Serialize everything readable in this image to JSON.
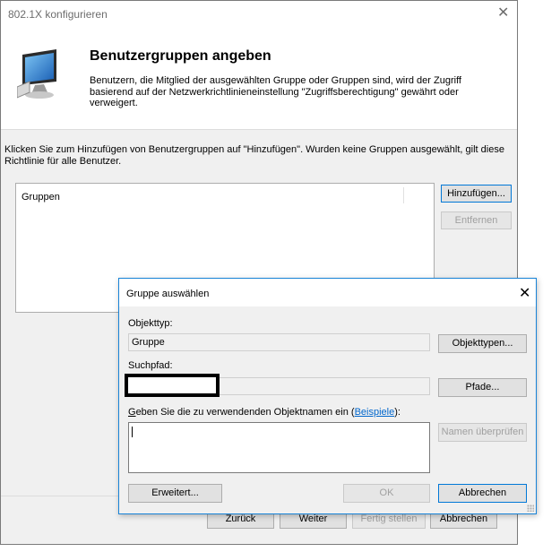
{
  "window": {
    "title": "802.1X konfigurieren",
    "close_glyph": "✕"
  },
  "header": {
    "icon": "monitor-icon",
    "title": "Benutzergruppen angeben",
    "description": "Benutzern, die Mitglied der ausgewählten Gruppe oder Gruppen sind, wird der Zugriff basierend auf der Netzwerkrichtlinieneinstellung \"Zugriffsberechtigung\" gewährt oder verweigert."
  },
  "info_text": "Klicken Sie zum Hinzufügen von Benutzergruppen auf \"Hinzufügen\". Wurden keine Gruppen ausgewählt, gilt diese Richtlinie für alle Benutzer.",
  "groups_list": {
    "column_header": "Gruppen",
    "items": []
  },
  "side_buttons": {
    "add": "Hinzufügen...",
    "remove": "Entfernen"
  },
  "footer_buttons": {
    "back": "Zurück",
    "next": "Weiter",
    "finish": "Fertig stellen",
    "cancel": "Abbrechen"
  },
  "select_group_dialog": {
    "title": "Gruppe auswählen",
    "close_glyph": "✕",
    "object_type_label": "Objekttyp:",
    "object_type_value": "Gruppe",
    "object_types_button": "Objekttypen...",
    "search_path_label": "Suchpfad:",
    "search_path_value": "",
    "paths_button": "Pfade...",
    "names_label_lead": "G",
    "names_label_rest": "eben Sie die zu verwendenden Objektnamen ein (",
    "names_label_link": "Beispiele",
    "names_label_tail": "):",
    "names_value": "",
    "check_names_button": "Namen überprüfen",
    "advanced_button": "Erweitert...",
    "ok_button": "OK",
    "cancel_button": "Abbrechen"
  },
  "colors": {
    "accent": "#0078d7",
    "link": "#0066cc",
    "dialog_background": "#f0f0f0"
  }
}
